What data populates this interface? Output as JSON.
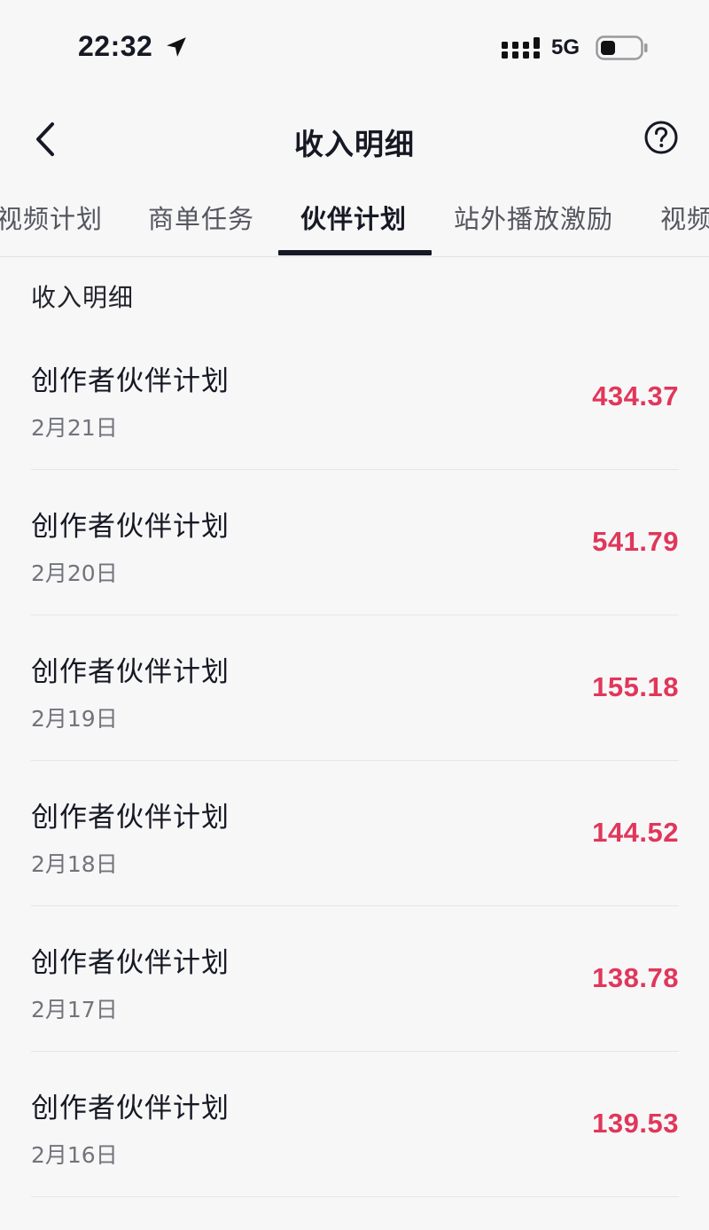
{
  "status_bar": {
    "time": "22:32",
    "network": "5G",
    "icons": [
      "location-arrow-icon",
      "signal-icon",
      "battery-icon"
    ]
  },
  "nav": {
    "title": "收入明细",
    "back_icon": "chevron-left-icon",
    "help_icon": "question-circle-icon"
  },
  "tabs": [
    {
      "label": "视频计划",
      "active": false
    },
    {
      "label": "商单任务",
      "active": false
    },
    {
      "label": "伙伴计划",
      "active": true
    },
    {
      "label": "站外播放激励",
      "active": false
    },
    {
      "label": "视频",
      "active": false
    }
  ],
  "section_label": "收入明细",
  "income_items": [
    {
      "title": "创作者伙伴计划",
      "date": "2月21日",
      "amount": "434.37"
    },
    {
      "title": "创作者伙伴计划",
      "date": "2月20日",
      "amount": "541.79"
    },
    {
      "title": "创作者伙伴计划",
      "date": "2月19日",
      "amount": "155.18"
    },
    {
      "title": "创作者伙伴计划",
      "date": "2月18日",
      "amount": "144.52"
    },
    {
      "title": "创作者伙伴计划",
      "date": "2月17日",
      "amount": "138.78"
    },
    {
      "title": "创作者伙伴计划",
      "date": "2月16日",
      "amount": "139.53"
    }
  ],
  "colors": {
    "amount": "#e0375a",
    "background": "#f7f7f8",
    "text": "#161823"
  }
}
